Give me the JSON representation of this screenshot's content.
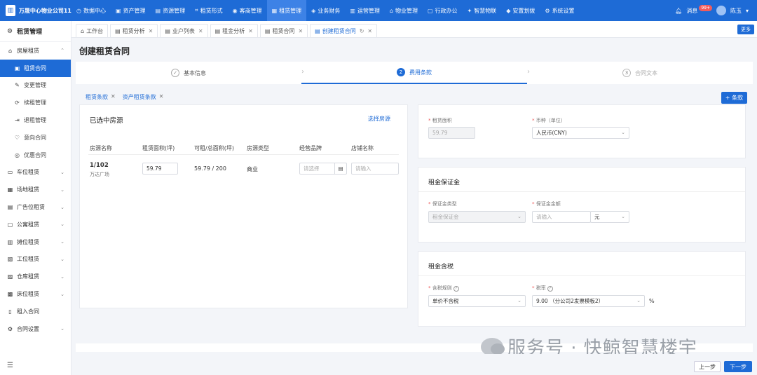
{
  "header": {
    "company": "万晟中心物业公司11",
    "nav": [
      {
        "label": "数据中心",
        "icon": "◷"
      },
      {
        "label": "资产管理",
        "icon": "▣"
      },
      {
        "label": "资源管理",
        "icon": "▤"
      },
      {
        "label": "租赁形式",
        "icon": "⌗"
      },
      {
        "label": "客商管理",
        "icon": "◉"
      },
      {
        "label": "租赁管理",
        "icon": "▦"
      },
      {
        "label": "业务财务",
        "icon": "◈"
      },
      {
        "label": "运营管理",
        "icon": "▥"
      },
      {
        "label": "物业管理",
        "icon": "⌂"
      },
      {
        "label": "行政办公",
        "icon": "▢"
      },
      {
        "label": "智慧物联",
        "icon": "✦"
      },
      {
        "label": "安置划拨",
        "icon": "◆"
      },
      {
        "label": "系统设置",
        "icon": "⚙"
      }
    ],
    "active_nav": "租赁管理",
    "messages_label": "消息",
    "messages_badge": "99+",
    "user_name": "陈玉"
  },
  "sidebar": {
    "title": "租赁管理",
    "items": [
      {
        "label": "房屋租赁",
        "type": "group",
        "open": true
      },
      {
        "label": "租赁合同",
        "type": "sub",
        "active": true
      },
      {
        "label": "变更管理",
        "type": "sub"
      },
      {
        "label": "续租管理",
        "type": "sub"
      },
      {
        "label": "退租管理",
        "type": "sub"
      },
      {
        "label": "意向合同",
        "type": "sub"
      },
      {
        "label": "优惠合同",
        "type": "sub"
      },
      {
        "label": "车位租赁",
        "type": "group"
      },
      {
        "label": "场地租赁",
        "type": "group"
      },
      {
        "label": "广告位租赁",
        "type": "group"
      },
      {
        "label": "公寓租赁",
        "type": "group"
      },
      {
        "label": "摊位租赁",
        "type": "group"
      },
      {
        "label": "工位租赁",
        "type": "group"
      },
      {
        "label": "仓库租赁",
        "type": "group"
      },
      {
        "label": "床位租赁",
        "type": "group"
      },
      {
        "label": "租入合同",
        "type": "item"
      },
      {
        "label": "合同设置",
        "type": "group"
      }
    ]
  },
  "tabs": [
    {
      "label": "工作台",
      "closable": false
    },
    {
      "label": "租赁分析",
      "closable": true
    },
    {
      "label": "业户列表",
      "closable": true
    },
    {
      "label": "租金分析",
      "closable": true
    },
    {
      "label": "租赁合同",
      "closable": true
    },
    {
      "label": "创建租赁合同",
      "closable": true,
      "active": true
    }
  ],
  "more_label": "更多",
  "page_title": "创建租赁合同",
  "steps": [
    {
      "num": "✓",
      "label": "基本信息",
      "state": "done"
    },
    {
      "num": "2",
      "label": "费用条款",
      "state": "current"
    },
    {
      "num": "3",
      "label": "合同文本",
      "state": "todo"
    }
  ],
  "subtabs": [
    "租赁条款",
    "资产租赁条款"
  ],
  "add_clause_label": "+ 条款",
  "rooms": {
    "title": "已选中房源",
    "select_link": "选择房源",
    "columns": [
      "房源名称",
      "租赁面积(坪)",
      "可租/总面积(坪)",
      "房源类型",
      "经营品牌",
      "店铺名称"
    ],
    "row": {
      "name": "1/102",
      "sub": "万达广场",
      "area": "59.79",
      "avail": "59.79 / 200",
      "type": "商业",
      "brand_placeholder": "请选择",
      "shop_placeholder": "请输入"
    }
  },
  "area_panel": {
    "area_label": "租赁面积",
    "area_value": "59.79",
    "currency_label": "币种（单位）",
    "currency_value": "人民币(CNY)"
  },
  "deposit_panel": {
    "title": "租金保证金",
    "type_label": "保证金类型",
    "type_value": "租金保证金",
    "amount_label": "保证金金额",
    "amount_placeholder": "请输入",
    "unit": "元"
  },
  "tax_panel": {
    "title": "租金含税",
    "rule_label": "含税规则",
    "rule_value": "单价不含税",
    "rate_label": "税率",
    "rate_value": "9.00 （分公司2发票模板2）",
    "pct": "%"
  },
  "buttons": {
    "prev": "上一步",
    "next": "下一步"
  },
  "watermark": "服务号 · 快鲸智慧楼宇"
}
